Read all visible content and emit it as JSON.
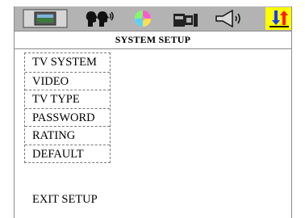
{
  "tabs": [
    {
      "icon": "monitor-icon"
    },
    {
      "icon": "speaking-heads-icon"
    },
    {
      "icon": "disc-icon"
    },
    {
      "icon": "speaker-system-icon"
    },
    {
      "icon": "speaker-sound-icon"
    },
    {
      "icon": "preferences-arrows-icon",
      "active": true
    }
  ],
  "title": "SYSTEM SETUP",
  "menu": {
    "items": [
      {
        "label": "TV SYSTEM"
      },
      {
        "label": "VIDEO"
      },
      {
        "label": "TV TYPE"
      },
      {
        "label": "PASSWORD"
      },
      {
        "label": "RATING"
      },
      {
        "label": "DEFAULT"
      }
    ]
  },
  "exit_label": "EXIT SETUP",
  "colors": {
    "icon_bar": "#b3b3b3",
    "active_tab": "#ffff00",
    "border": "#8a8a8a"
  }
}
